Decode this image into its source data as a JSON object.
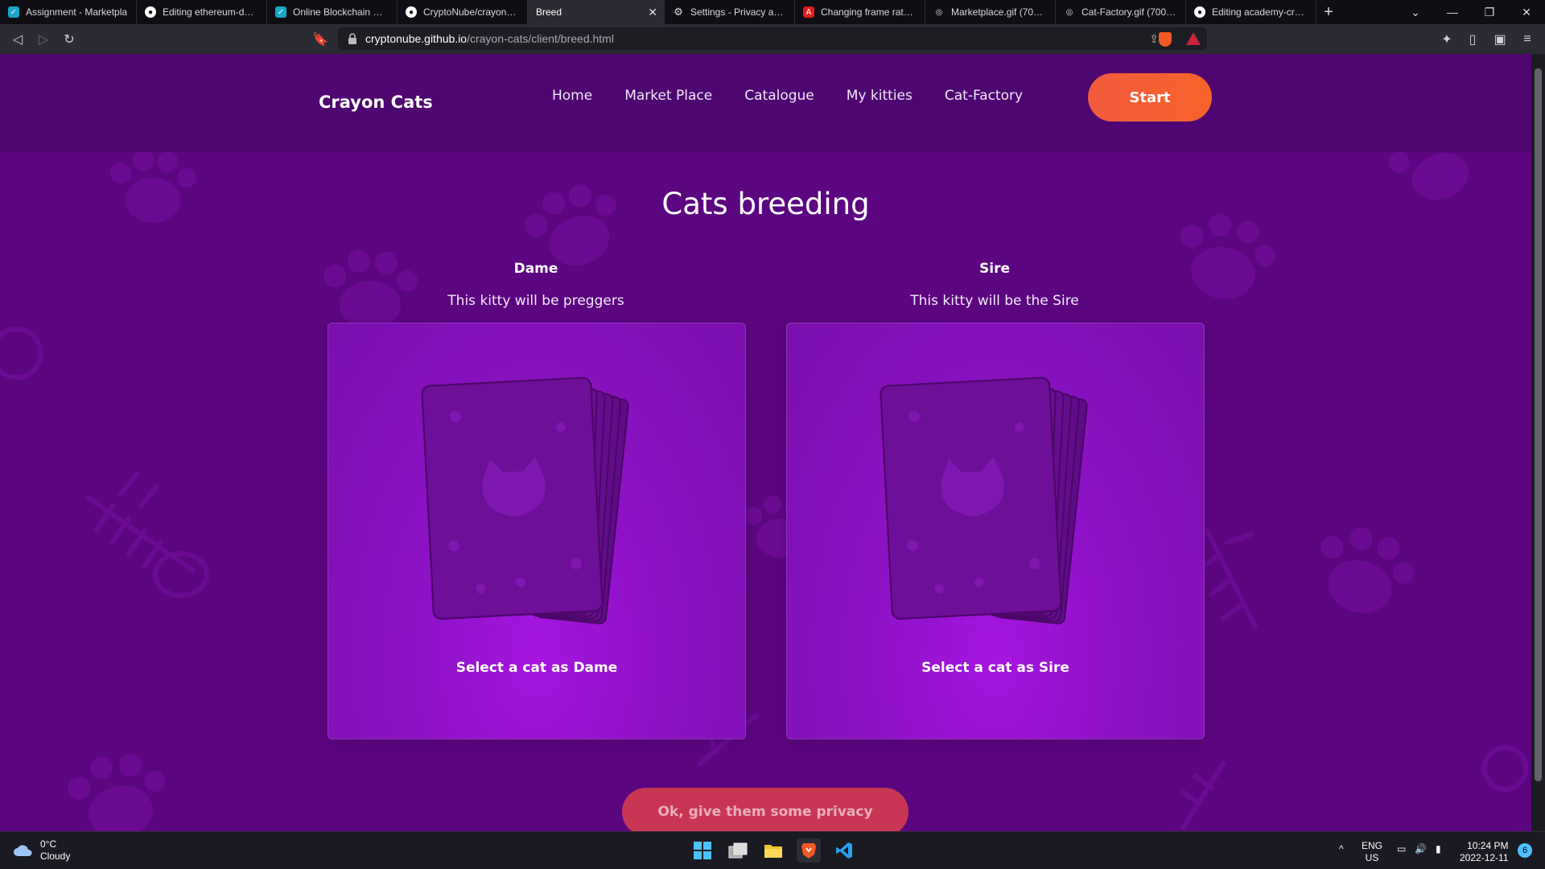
{
  "browser": {
    "tabs": [
      {
        "label": "Assignment - Marketpla",
        "icon": "academy-icon",
        "active": false
      },
      {
        "label": "Editing ethereum-dapp",
        "icon": "github-icon",
        "active": false
      },
      {
        "label": "Online Blockchain Cour",
        "icon": "academy-icon",
        "active": false
      },
      {
        "label": "CryptoNube/crayon-cat",
        "icon": "github-icon",
        "active": false
      },
      {
        "label": "Breed",
        "icon": "blank-icon",
        "active": true
      },
      {
        "label": "Settings - Privacy and se",
        "icon": "gear-icon",
        "active": false
      },
      {
        "label": "Changing frame rate ch",
        "icon": "adobe-icon",
        "active": false
      },
      {
        "label": "Marketplace.gif (700×39",
        "icon": "globe-icon",
        "active": false
      },
      {
        "label": "Cat-Factory.gif (700×39",
        "icon": "globe-icon",
        "active": false
      },
      {
        "label": "Editing academy-crypto",
        "icon": "github-icon",
        "active": false
      }
    ],
    "url_host": "cryptonube.github.io",
    "url_path": "/crayon-cats/client/breed.html"
  },
  "site": {
    "logo": "Crayon Cats",
    "nav": [
      "Home",
      "Market Place",
      "Catalogue",
      "My kitties",
      "Cat-Factory"
    ],
    "start_label": "Start",
    "title": "Cats breeding",
    "dame": {
      "heading": "Dame",
      "description": "This kitty will be preggers",
      "select_label": "Select a cat as Dame"
    },
    "sire": {
      "heading": "Sire",
      "description": "This kitty will be the Sire",
      "select_label": "Select a cat as Sire"
    },
    "privacy_button": "Ok, give them some privacy"
  },
  "taskbar": {
    "temperature": "0°C",
    "condition": "Cloudy",
    "lang_top": "ENG",
    "lang_bottom": "US",
    "time": "10:24 PM",
    "date": "2022-12-11",
    "notification_count": "6"
  },
  "colors": {
    "page_bg": "#5b0680",
    "header_bg": "#4e0670",
    "start_button": "#f15a3d",
    "privacy_button": "#c93654",
    "panel_glow": "#a614e0"
  }
}
